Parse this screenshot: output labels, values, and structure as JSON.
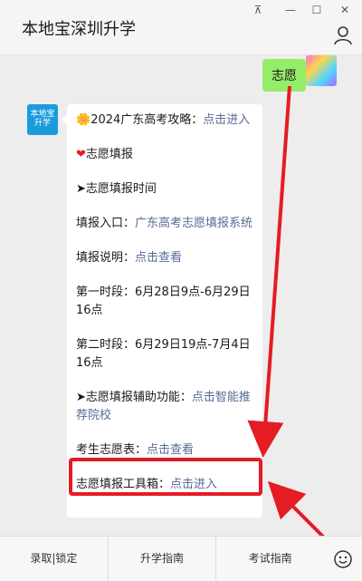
{
  "window": {
    "title": "本地宝深圳升学",
    "pin": "⊼",
    "min": "—",
    "max": "☐",
    "close": "✕"
  },
  "chat": {
    "sent": "志愿",
    "logo_line1": "本地宝",
    "logo_line2": "升学",
    "lines": [
      {
        "emoji": "🌼",
        "text": "2024广东高考攻略：",
        "link": "点击进入"
      },
      {
        "emoji": "❤",
        "text": "志愿填报",
        "link": ""
      },
      {
        "emoji": "➤",
        "text": "志愿填报时间",
        "link": ""
      },
      {
        "emoji": "",
        "text": "填报入口：",
        "link": "广东高考志愿填报系统"
      },
      {
        "emoji": "",
        "text": "填报说明：",
        "link": "点击查看"
      },
      {
        "emoji": "",
        "text": "第一时段：6月28日9点-6月29日16点",
        "link": ""
      },
      {
        "emoji": "",
        "text": "第二时段：6月29日19点-7月4日16点",
        "link": ""
      },
      {
        "emoji": "➤",
        "text": "志愿填报辅助功能：",
        "link": "点击智能推荐院校"
      },
      {
        "emoji": "",
        "text": "考生志愿表：",
        "link": "点击查看"
      },
      {
        "emoji": "",
        "text": "志愿填报工具箱：",
        "link": "点击进入"
      }
    ]
  },
  "bottom_tabs": [
    "录取|锁定",
    "升学指南",
    "考试指南"
  ],
  "colors": {
    "accent_red": "#e51c23",
    "link": "#576b95",
    "bubble_green": "#95ec69"
  }
}
